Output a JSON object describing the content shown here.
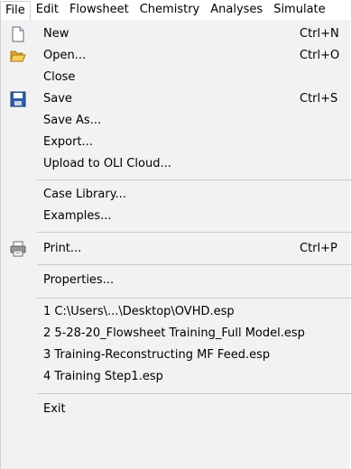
{
  "menubar": {
    "items": [
      "File",
      "Edit",
      "Flowsheet",
      "Chemistry",
      "Analyses",
      "Simulate"
    ]
  },
  "file_menu": {
    "new": {
      "label": "New",
      "shortcut": "Ctrl+N",
      "icon": "new-document-icon"
    },
    "open": {
      "label": "Open...",
      "shortcut": "Ctrl+O",
      "icon": "folder-open-icon"
    },
    "close": {
      "label": "Close"
    },
    "save": {
      "label": "Save",
      "shortcut": "Ctrl+S",
      "icon": "floppy-disk-icon"
    },
    "save_as": {
      "label": "Save As..."
    },
    "export": {
      "label": "Export..."
    },
    "upload": {
      "label": "Upload to OLI Cloud..."
    },
    "case_library": {
      "label": "Case Library..."
    },
    "examples": {
      "label": "Examples..."
    },
    "print": {
      "label": "Print...",
      "shortcut": "Ctrl+P",
      "icon": "printer-icon"
    },
    "properties": {
      "label": "Properties..."
    },
    "recent": [
      "1 C:\\Users\\...\\Desktop\\OVHD.esp",
      "2 5-28-20_Flowsheet Training_Full Model.esp",
      "3 Training-Reconstructing MF Feed.esp",
      "4 Training Step1.esp"
    ],
    "exit": {
      "label": "Exit"
    }
  },
  "colors": {
    "menu_background": "#f2f2f2",
    "separator": "#c9c9c9",
    "menubar_background": "#ffffff"
  }
}
